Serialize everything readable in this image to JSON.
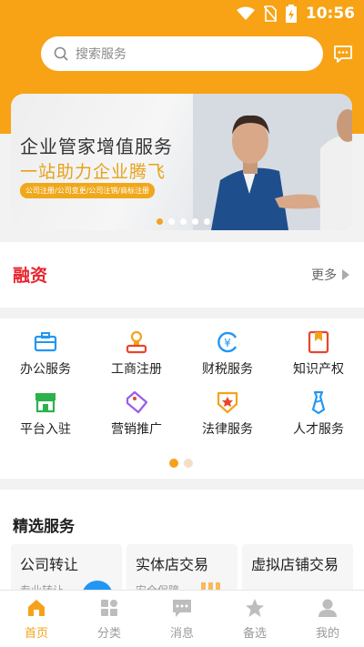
{
  "status_bar": {
    "time": "10:56"
  },
  "search": {
    "placeholder": "搜索服务"
  },
  "banner": {
    "line1": "企业管家增值服务",
    "line2": "一站助力企业腾飞",
    "tags": "公司注册/公司变更/公司注销/商标注册",
    "slide_count": 5,
    "active_slide": 1
  },
  "finance": {
    "logo_text": "融资",
    "more_label": "更多"
  },
  "services_grid": {
    "items": [
      {
        "label": "办公服务",
        "icon": "briefcase-icon",
        "color": "#2196f3"
      },
      {
        "label": "工商注册",
        "icon": "stamp-icon",
        "color": "#f5a21b"
      },
      {
        "label": "财税服务",
        "icon": "yuan-icon",
        "color": "#2196f3"
      },
      {
        "label": "知识产权",
        "icon": "certificate-icon",
        "color": "#e8452e"
      },
      {
        "label": "平台入驻",
        "icon": "store-icon",
        "color": "#2bb24c"
      },
      {
        "label": "营销推广",
        "icon": "tag-icon",
        "color": "#9b5de5"
      },
      {
        "label": "法律服务",
        "icon": "badge-icon",
        "color": "#f5a21b"
      },
      {
        "label": "人才服务",
        "icon": "tie-icon",
        "color": "#2196f3"
      }
    ],
    "page_count": 2,
    "active_page": 1
  },
  "featured": {
    "title": "精选服务",
    "cards": [
      {
        "title": "公司转让",
        "sub": "专业转让"
      },
      {
        "title": "实体店交易",
        "sub": "安全保障"
      },
      {
        "title": "虚拟店铺交易",
        "sub": ""
      }
    ]
  },
  "tabbar": {
    "tabs": [
      {
        "label": "首页",
        "icon": "home-icon",
        "active": true
      },
      {
        "label": "分类",
        "icon": "category-icon",
        "active": false
      },
      {
        "label": "消息",
        "icon": "message-icon",
        "active": false
      },
      {
        "label": "备选",
        "icon": "star-icon",
        "active": false
      },
      {
        "label": "我的",
        "icon": "user-icon",
        "active": false
      }
    ]
  },
  "colors": {
    "brand": "#f7a315",
    "accent": "#f5a21b",
    "finance_red": "#e8252e"
  }
}
